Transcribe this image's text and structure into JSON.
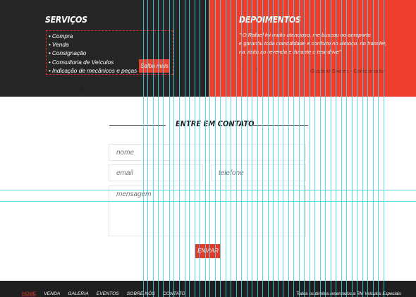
{
  "services": {
    "title": "SERVIÇOS",
    "items": [
      {
        "bullet": "•",
        "label": "Compra"
      },
      {
        "bullet": "•",
        "label": "Venda"
      },
      {
        "bullet": "•",
        "label": "Consignação"
      },
      {
        "bullet": "•",
        "label": "Consultoria de Veículos"
      },
      {
        "bullet": "•",
        "label": "Indicação de mecânicos e peças"
      }
    ],
    "button_label": "Saiba mais"
  },
  "testimonials": {
    "title": "DEPOIMENTOS",
    "quote_lines": [
      "\" O Rafael foi muito atencioso, me buscou no aeroporto",
      "e garantiu toda comodidade e conforto no almoço, no transfer,",
      "na visita ao revenda e durante o test-drive\""
    ],
    "prev_icon": "‹",
    "next_icon": "›",
    "author": "Gustavo Soares - Colecionador"
  },
  "contact": {
    "title": "ENTRE EM CONTATO",
    "name_placeholder": "nome",
    "email_placeholder": "email",
    "phone_placeholder": "telefone",
    "message_placeholder": "mensagem",
    "submit_label": "ENVIAR"
  },
  "footer": {
    "nav": [
      {
        "label": "HOME",
        "active": true
      },
      {
        "label": "VENDA",
        "active": false
      },
      {
        "label": "GALERIA",
        "active": false
      },
      {
        "label": "EVENTOS",
        "active": false
      },
      {
        "label": "SOBRE NÓS",
        "active": false
      },
      {
        "label": "CONTATO",
        "active": false
      }
    ],
    "copyright": "Todos os direitos reservados a RM Veículos Especiais"
  },
  "colors": {
    "dark_panel": "#262626",
    "accent_red": "#ee3f2e",
    "guide_cyan": "#40d6e8"
  }
}
